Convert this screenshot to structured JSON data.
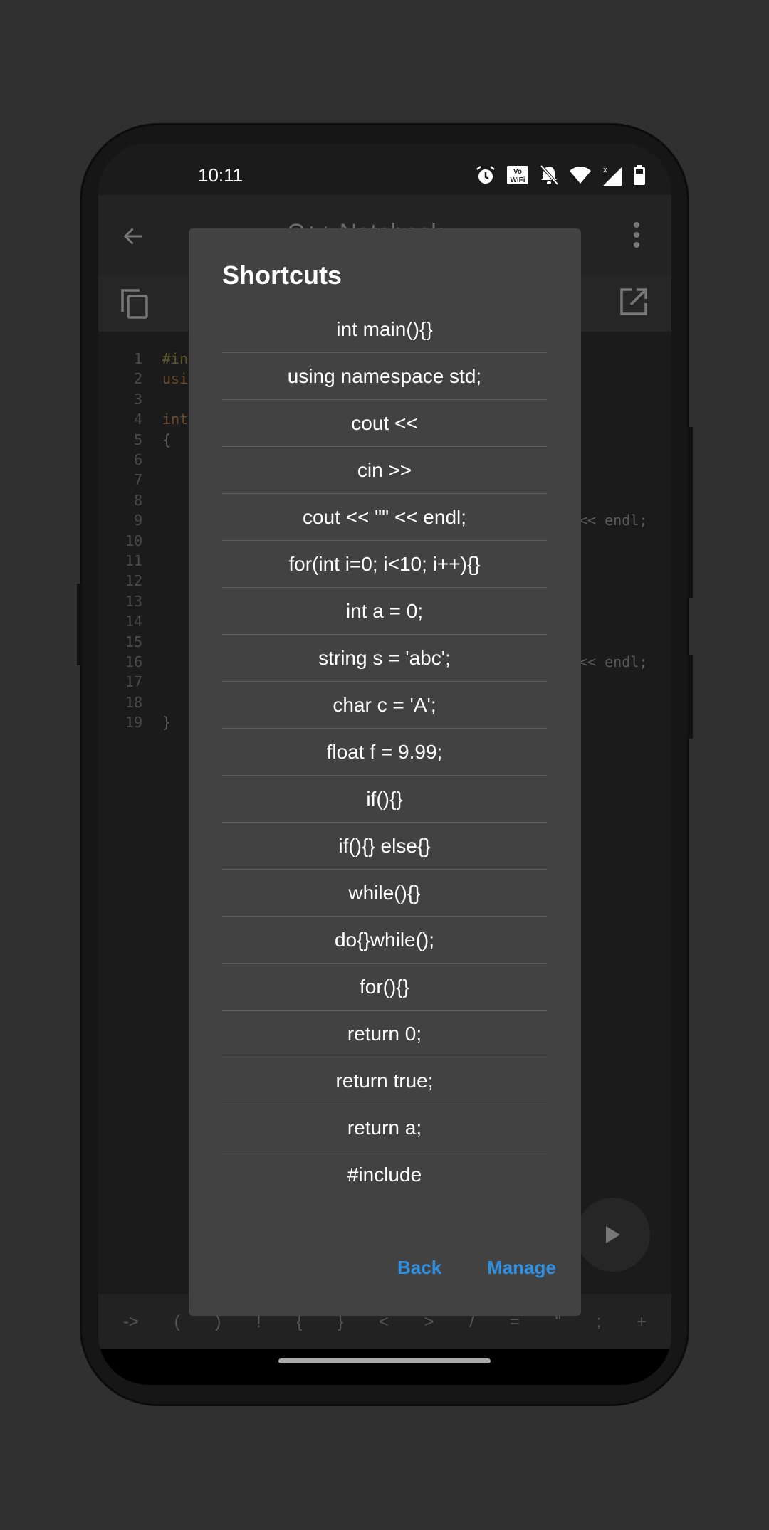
{
  "status_bar": {
    "time": "10:11",
    "icons": [
      "alarm-icon",
      "vowifi-icon",
      "bell-off-icon",
      "wifi-icon",
      "signal-icon",
      "battery-icon"
    ]
  },
  "app_bar": {
    "title": "C++ Notebook",
    "icons": [
      "back-arrow-icon",
      "more-vert-icon"
    ]
  },
  "toolbar": {
    "icons": [
      "copy-icon",
      "open-external-icon"
    ]
  },
  "editor": {
    "line_numbers": [
      "1",
      "2",
      "3",
      "4",
      "5",
      "6",
      "7",
      "8",
      "9",
      "10",
      "11",
      "12",
      "13",
      "14",
      "15",
      "16",
      "17",
      "18",
      "19"
    ],
    "visible_code": {
      "1": "#in",
      "2": "usi",
      "4": "int",
      "5": "{",
      "19": "}"
    },
    "visible_code_right": {
      "9": "<< endl;",
      "16": "<< endl;"
    }
  },
  "symbol_bar": [
    "->",
    "(",
    ")",
    "!",
    "{",
    "}",
    "<",
    ">",
    "/",
    "=",
    "\"",
    ";",
    "+"
  ],
  "dialog": {
    "title": "Shortcuts",
    "items": [
      "int main(){}",
      "using namespace std;",
      "cout <<",
      "cin >>",
      "cout << \"\" << endl;",
      "for(int i=0; i<10; i++){}",
      "int a = 0;",
      "string s = 'abc';",
      "char c = 'A';",
      "float f = 9.99;",
      "if(){}",
      "if(){} else{}",
      "while(){}",
      "do{}while();",
      "for(){}",
      "return 0;",
      "return true;",
      "return a;",
      "#include"
    ],
    "back_label": "Back",
    "manage_label": "Manage"
  },
  "colors": {
    "accent": "#2f8fe0",
    "dialog_bg": "#424242",
    "background": "#303030"
  }
}
